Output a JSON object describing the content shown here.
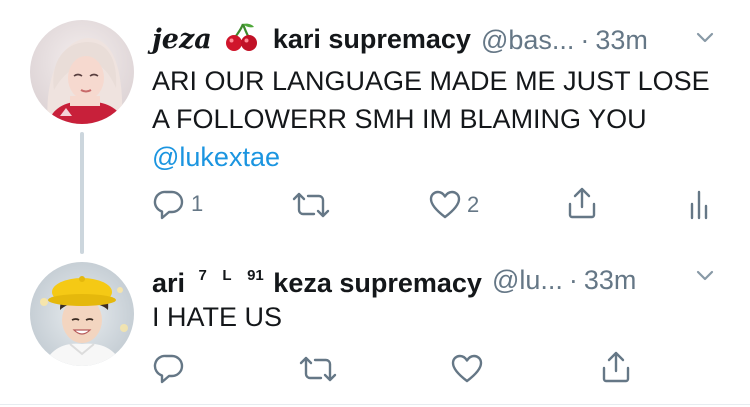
{
  "tweets": [
    {
      "display_name_prefix": "jeza",
      "display_name_emoji": "cherries-emoji",
      "display_name_suffix": "kari supremacy",
      "handle": "@bas...",
      "separator": "·",
      "time": "33m",
      "text": "ARI OUR LANGUAGE MADE ME JUST LOSE A FOLLOWERR SMH IM BLAMING YOU",
      "mention": "@lukextae",
      "reply_count": "1",
      "retweet_count": "",
      "like_count": "2",
      "avatar_icon": "avatar-photo-girl",
      "icons": [
        "reply-icon",
        "retweet-icon",
        "heart-icon",
        "share-icon",
        "analytics-icon",
        "chevron-down-icon"
      ]
    },
    {
      "display_name_prefix": "ari",
      "display_name_sup1": "7",
      "display_name_sup2": "L",
      "display_name_sup3": "91",
      "display_name_suffix": "keza supremacy",
      "handle": "@lu...",
      "separator": "·",
      "time": "33m",
      "text": "I HATE US",
      "reply_count": "",
      "retweet_count": "",
      "like_count": "",
      "avatar_icon": "avatar-photo-boy-yellow-hat",
      "icons": [
        "reply-icon",
        "retweet-icon",
        "heart-icon",
        "share-icon",
        "chevron-down-icon"
      ]
    }
  ],
  "colors": {
    "text": "#14171a",
    "secondary": "#657786",
    "link": "#1b95e0",
    "thread_line": "#ccd6dd"
  }
}
